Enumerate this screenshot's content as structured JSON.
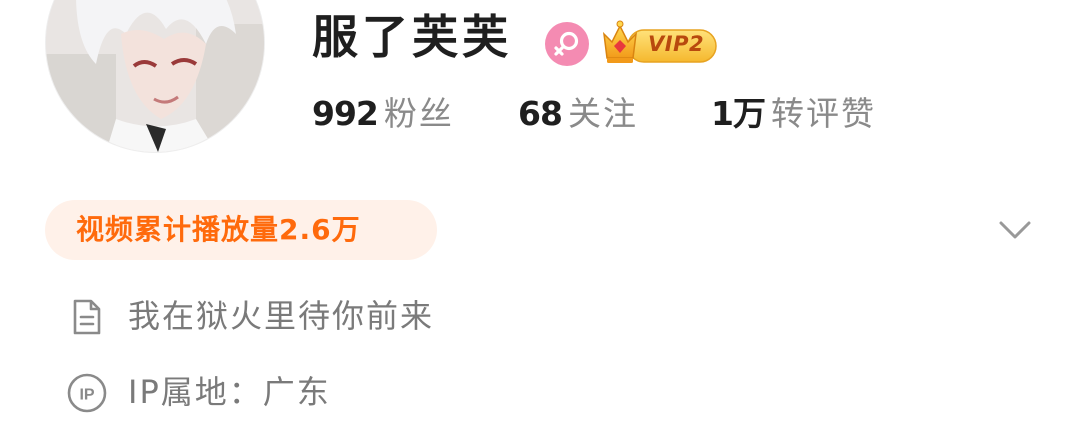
{
  "profile": {
    "avatar": "avatar-illustration",
    "name": "服了芙芙",
    "gender_icon": "female-icon",
    "vip": {
      "icon": "crown-icon",
      "label": "VIP2"
    }
  },
  "stats": [
    {
      "value": "992",
      "label": "粉丝"
    },
    {
      "value": "68",
      "label": "关注"
    },
    {
      "value": "1万",
      "label": "转评赞"
    }
  ],
  "highlight": {
    "text": "视频累计播放量2.6万",
    "expand_icon": "chevron-down-icon"
  },
  "info": {
    "bio": {
      "icon": "document-icon",
      "text": "我在狱火里待你前来"
    },
    "ip": {
      "icon": "ip-icon",
      "text": "IP属地：广东"
    }
  },
  "colors": {
    "accent": "#ff6a0c",
    "pill_bg": "#fff1e9",
    "female_badge": "#f48bb2",
    "vip_gold": "#f5b82e"
  }
}
